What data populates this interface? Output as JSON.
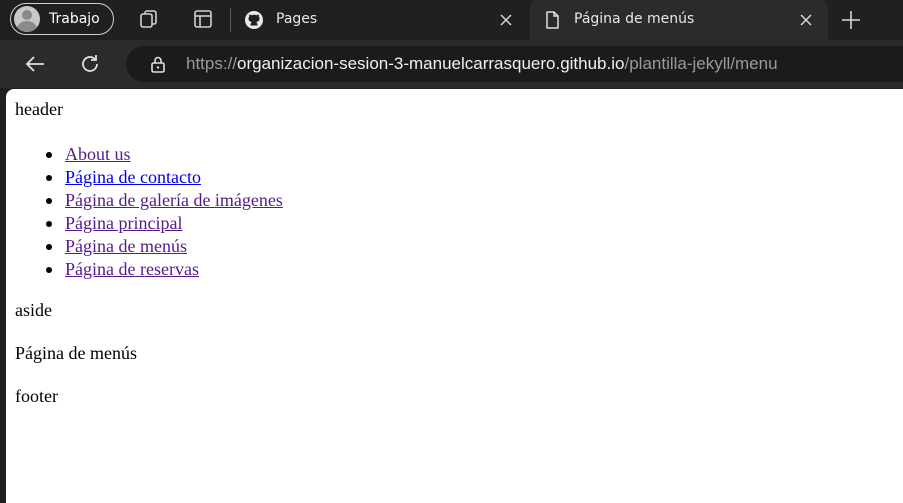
{
  "browser": {
    "profile_label": "Trabajo",
    "tabs": [
      {
        "title": "Pages",
        "icon": "github-icon",
        "active": false
      },
      {
        "title": "Página de menús",
        "icon": "document-icon",
        "active": true
      }
    ],
    "url": {
      "scheme": "https://",
      "host": "organizacion-sesion-3-manuelcarrasquero.github.io",
      "path": "/plantilla-jekyll/menu"
    },
    "colors": {
      "chrome_bg": "#202020",
      "toolbar_bg": "#2b2b2b",
      "omnibox_bg": "#1b1b1b"
    }
  },
  "page": {
    "header": "header",
    "nav": [
      {
        "label": "About us"
      },
      {
        "label": "Página de contacto"
      },
      {
        "label": "Página de galería de imágenes"
      },
      {
        "label": "Página principal"
      },
      {
        "label": "Página de menús"
      },
      {
        "label": "Página de reservas"
      }
    ],
    "aside": "aside",
    "main": "Página de menús",
    "footer": "footer",
    "colors": {
      "link_visited": "#551a8b",
      "link_unvisited": "#0000ee"
    }
  }
}
